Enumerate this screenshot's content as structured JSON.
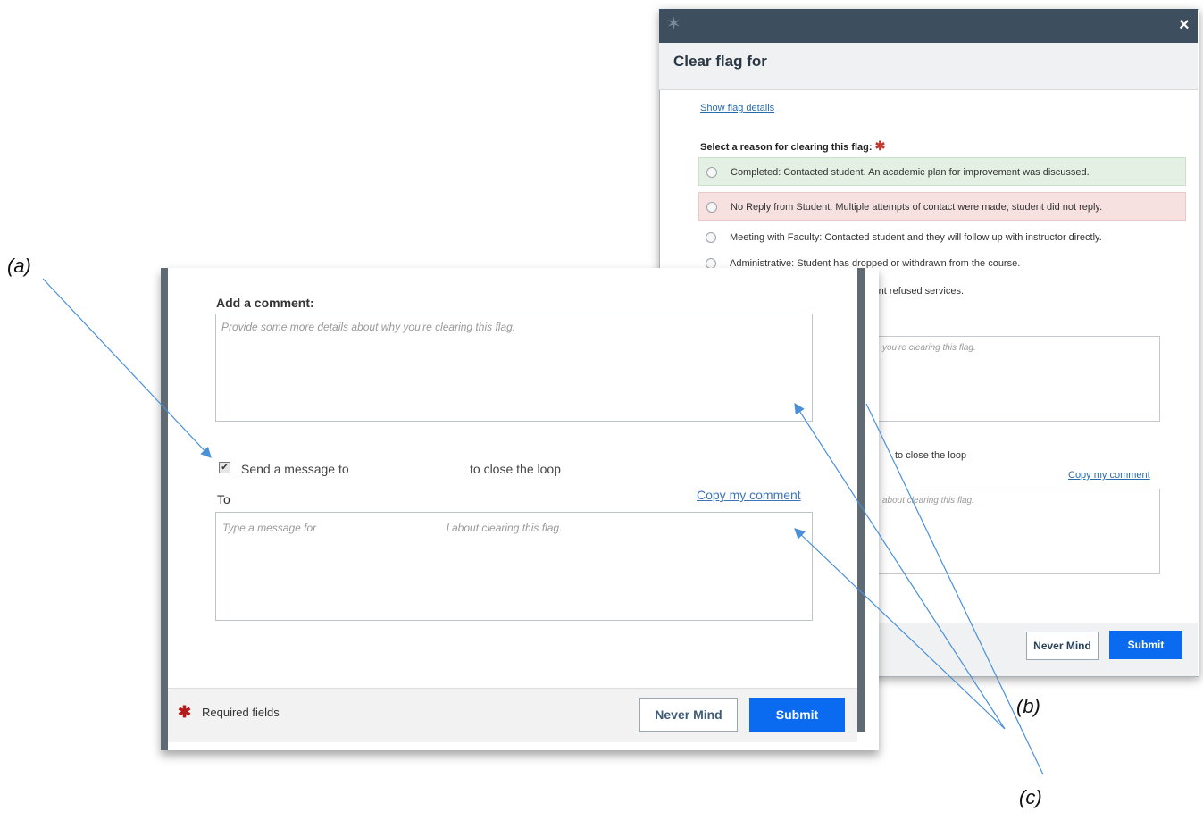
{
  "back_modal": {
    "title": "Clear flag for",
    "close_glyph": "×",
    "logo_glyph": "✶",
    "show_flag_details": "Show flag details",
    "reason_label": "Select a reason for clearing this flag:",
    "required_star": "✱",
    "reasons": [
      {
        "label": "Completed: Contacted student. An academic plan for improvement was discussed.",
        "color": "#e3f0e3"
      },
      {
        "label": "No Reply from Student: Multiple attempts of contact were made; student did not reply.",
        "color": "#f6e0e0"
      },
      {
        "label": "Meeting with Faculty: Contacted student and they will follow up with instructor directly."
      },
      {
        "label": "Administrative: Student has dropped or withdrawn from the course."
      }
    ],
    "partial_reason_text": "ident refused services.",
    "comment_placeholder_partial": "you're clearing this flag.",
    "close_loop_partial": "to close the loop",
    "copy_my_comment": "Copy my comment",
    "message_placeholder_partial": "about clearing this flag.",
    "never_mind": "Never Mind",
    "submit": "Submit"
  },
  "front_modal": {
    "comment_label": "Add a comment:",
    "comment_placeholder": "Provide some more details about why you're clearing this flag.",
    "send_message_checked": true,
    "checkbox_glyph": "✔",
    "send_message_prefix": "Send a message to",
    "send_message_suffix": "to close the loop",
    "to_label": "To",
    "copy_my_comment": "Copy my comment",
    "message_placeholder_prefix": "Type a message for",
    "message_placeholder_suffix": "l about clearing this flag.",
    "required_star": "✱",
    "required_fields": "Required fields",
    "never_mind": "Never Mind",
    "submit": "Submit"
  },
  "annotations": {
    "a": "(a)",
    "b": "(b)",
    "c": "(c)",
    "arrow_color": "#4a90d9"
  },
  "colors": {
    "accent_blue": "#0a6af0",
    "topbar": "#3d4e5e",
    "required_red": "#b51b1b"
  }
}
